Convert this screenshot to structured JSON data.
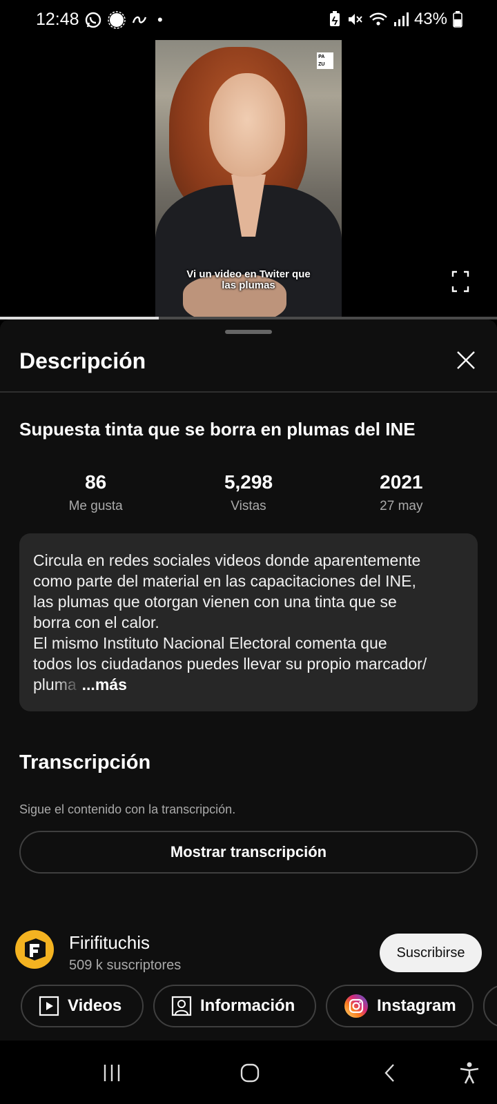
{
  "status_bar": {
    "time": "12:48",
    "battery": "43%",
    "dot": "•"
  },
  "video": {
    "caption_line1": "Vi un video en Twiter que",
    "caption_line2": "las plumas",
    "logo_letters": [
      "PA",
      "ZU"
    ],
    "progress": 0.32
  },
  "sheet": {
    "title": "Descripción",
    "video_title": "Supuesta tinta que se borra en plumas del INE",
    "stats": [
      {
        "value": "86",
        "label": "Me gusta"
      },
      {
        "value": "5,298",
        "label": "Vistas"
      },
      {
        "value": "2021",
        "label": "27 may"
      }
    ],
    "description": {
      "lines": [
        "Circula en redes sociales videos donde aparentemente",
        "como parte del material en las capacitaciones del INE,",
        "las plumas que otorgan vienen con una tinta que se",
        "borra con el calor.",
        "El mismo Instituto Nacional Electoral comenta que",
        "todos los ciudadanos puedes llevar su propio marcador/"
      ],
      "last_fragment": "pluma",
      "more": "...más"
    },
    "transcript": {
      "title": "Transcripción",
      "subtitle": "Sigue el contenido con la transcripción.",
      "button": "Mostrar transcripción"
    },
    "channel": {
      "name": "Firifituchis",
      "subscribers": "509 k suscriptores",
      "subscribe": "Suscribirse",
      "accent": "#f4b321"
    },
    "chips": [
      {
        "label": "Videos",
        "icon": "play-box-icon"
      },
      {
        "label": "Información",
        "icon": "person-box-icon"
      },
      {
        "label": "Instagram",
        "icon": "instagram-icon"
      }
    ]
  },
  "colors": {
    "sheet_bg": "#0f0f0f",
    "box_bg": "#272727",
    "muted": "#aaaaaa"
  }
}
